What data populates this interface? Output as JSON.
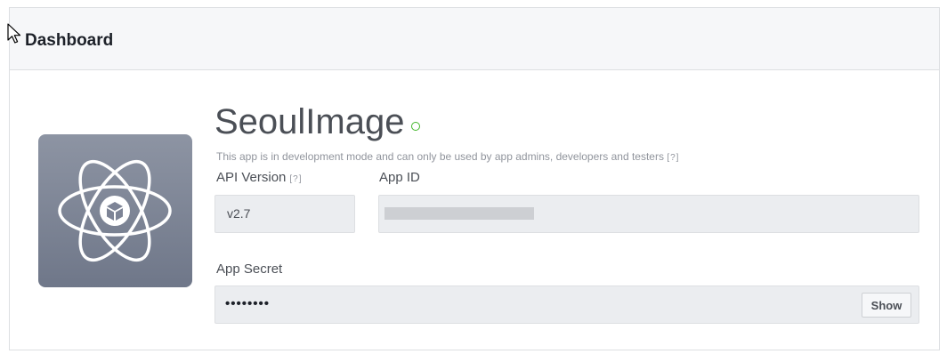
{
  "header": {
    "title": "Dashboard"
  },
  "app": {
    "name": "SeoulImage",
    "status_color": "#42b72a",
    "icon": "atom-cube-icon",
    "dev_note": "This app is in development mode and can only be used by app admins, developers and testers",
    "help_marker": "[?]"
  },
  "fields": {
    "api_version": {
      "label": "API Version",
      "value": "v2.7"
    },
    "app_id": {
      "label": "App ID",
      "value": ""
    },
    "app_secret": {
      "label": "App Secret",
      "value": "••••••••",
      "show_label": "Show"
    }
  }
}
